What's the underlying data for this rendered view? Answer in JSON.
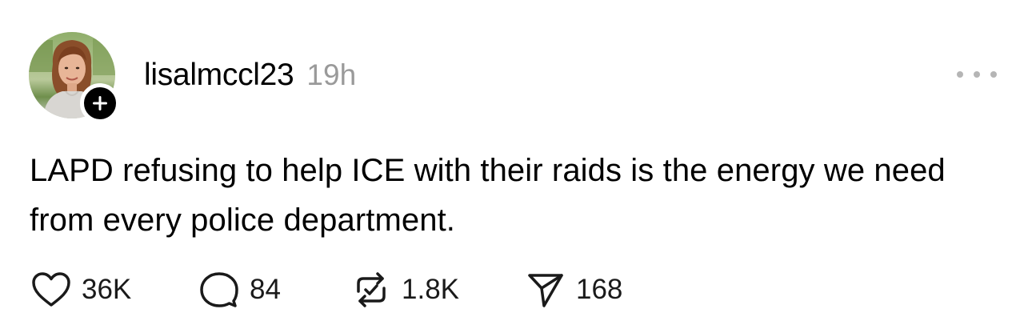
{
  "post": {
    "author": {
      "username": "lisalmccl23",
      "timestamp": "19h",
      "avatar": "avatar-photo",
      "follow_icon": "plus-icon"
    },
    "more_icon": "more-horizontal-icon",
    "text": "LAPD refusing to help ICE with their raids is the energy we need from every police department.",
    "actions": {
      "likes": "36K",
      "replies": "84",
      "reposts": "1.8K",
      "shares": "168"
    },
    "icons": {
      "like": "heart-icon",
      "reply": "comment-bubble-icon",
      "repost": "repost-icon",
      "share": "send-icon"
    }
  },
  "colors": {
    "text": "#000000",
    "muted": "#9a9a9a",
    "badge": "#000000"
  }
}
